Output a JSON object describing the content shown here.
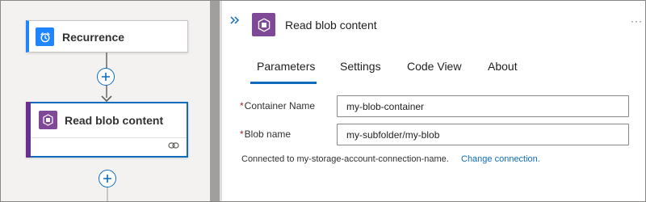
{
  "designer": {
    "trigger": {
      "title": "Recurrence",
      "icon": "alarm-clock-icon",
      "color": "#1f85ff"
    },
    "action": {
      "title": "Read blob content",
      "icon": "blob-storage-icon",
      "color": "#804998"
    }
  },
  "details": {
    "title": "Read blob content",
    "icon": "blob-storage-icon",
    "more_label": "···",
    "tabs": [
      {
        "label": "Parameters",
        "selected": true
      },
      {
        "label": "Settings",
        "selected": false
      },
      {
        "label": "Code View",
        "selected": false
      },
      {
        "label": "About",
        "selected": false
      }
    ],
    "fields": [
      {
        "required_marker": "*",
        "label": "Container Name",
        "value": "my-blob-container"
      },
      {
        "required_marker": "*",
        "label": "Blob name",
        "value": "my-subfolder/my-blob"
      }
    ],
    "connection_text": "Connected to my-storage-account-connection-name.",
    "change_connection_label": "Change connection."
  },
  "colors": {
    "accent": "#0f6cbd",
    "trigger_blue": "#1f85ff",
    "action_purple": "#804998",
    "required_red": "#a4262c"
  }
}
